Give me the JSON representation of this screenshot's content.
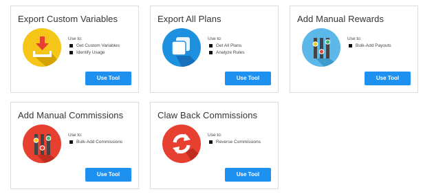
{
  "cards": [
    {
      "title": "Export Custom Variables",
      "icon": "download-tray-icon",
      "icon_color": "#f5c518",
      "use_label": "Use to:",
      "uses": [
        "Get Custom Variables",
        "Identify Usage"
      ],
      "button": "Use Tool"
    },
    {
      "title": "Export All Plans",
      "icon": "stacked-pages-icon",
      "icon_color": "#1e90e0",
      "use_label": "Use to:",
      "uses": [
        "Get All Plans",
        "Analyze Rules"
      ],
      "button": "Use Tool"
    },
    {
      "title": "Add Manual Rewards",
      "icon": "sliders-icon",
      "icon_color": "#5bb8e8",
      "use_label": "Use to:",
      "uses": [
        "Bulk-Add Payouts"
      ],
      "button": "Use Tool"
    },
    {
      "title": "Add Manual Commissions",
      "icon": "sliders-icon",
      "icon_color": "#e84030",
      "use_label": "Use to:",
      "uses": [
        "Bulk-Add Commissions"
      ],
      "button": "Use Tool"
    },
    {
      "title": "Claw Back Commissions",
      "icon": "refresh-arrows-icon",
      "icon_color": "#e84030",
      "use_label": "Use to:",
      "uses": [
        "Reverse Commissions"
      ],
      "button": "Use Tool"
    }
  ],
  "colors": {
    "button": "#1e90f0",
    "card_border": "#dcdcdc"
  }
}
